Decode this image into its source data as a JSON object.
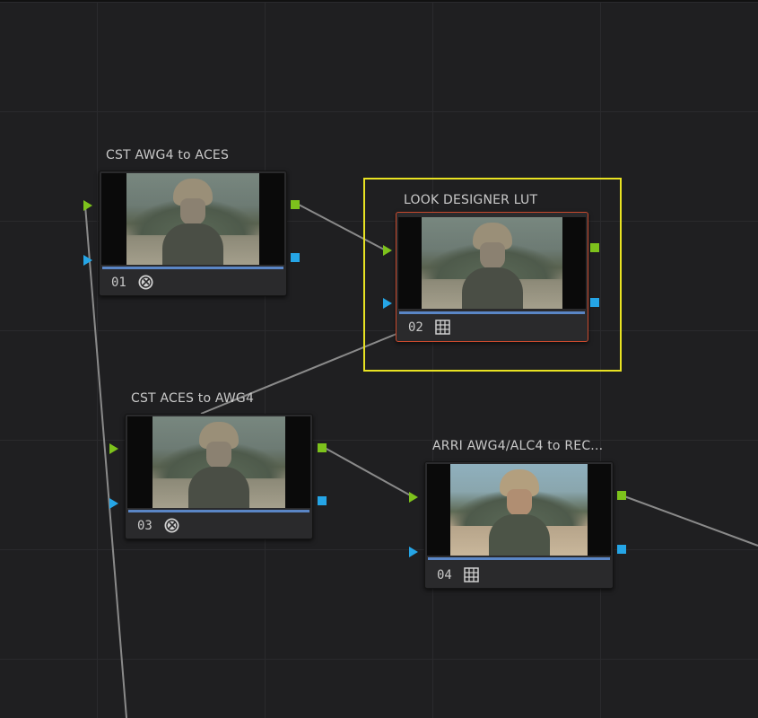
{
  "nodes": [
    {
      "title": "CST AWG4 to ACES",
      "number": "01",
      "icon": "color-space-transform-icon",
      "selected": false
    },
    {
      "title": "LOOK DESIGNER LUT",
      "number": "02",
      "icon": "lut-grid-icon",
      "selected": true
    },
    {
      "title": "CST ACES to AWG4",
      "number": "03",
      "icon": "color-space-transform-icon",
      "selected": false
    },
    {
      "title": "ARRI AWG4/ALC4 to REC...",
      "number": "04",
      "icon": "lut-grid-icon",
      "selected": false
    }
  ],
  "colors": {
    "background": "#1f1f21",
    "grid_line": "#2a2a2d",
    "rgb_port": "#7dc21c",
    "key_port": "#25a5e6",
    "selected_node_border": "#c94a2e",
    "selection_box": "#e8e222",
    "node_bar": "#5a86c6"
  }
}
